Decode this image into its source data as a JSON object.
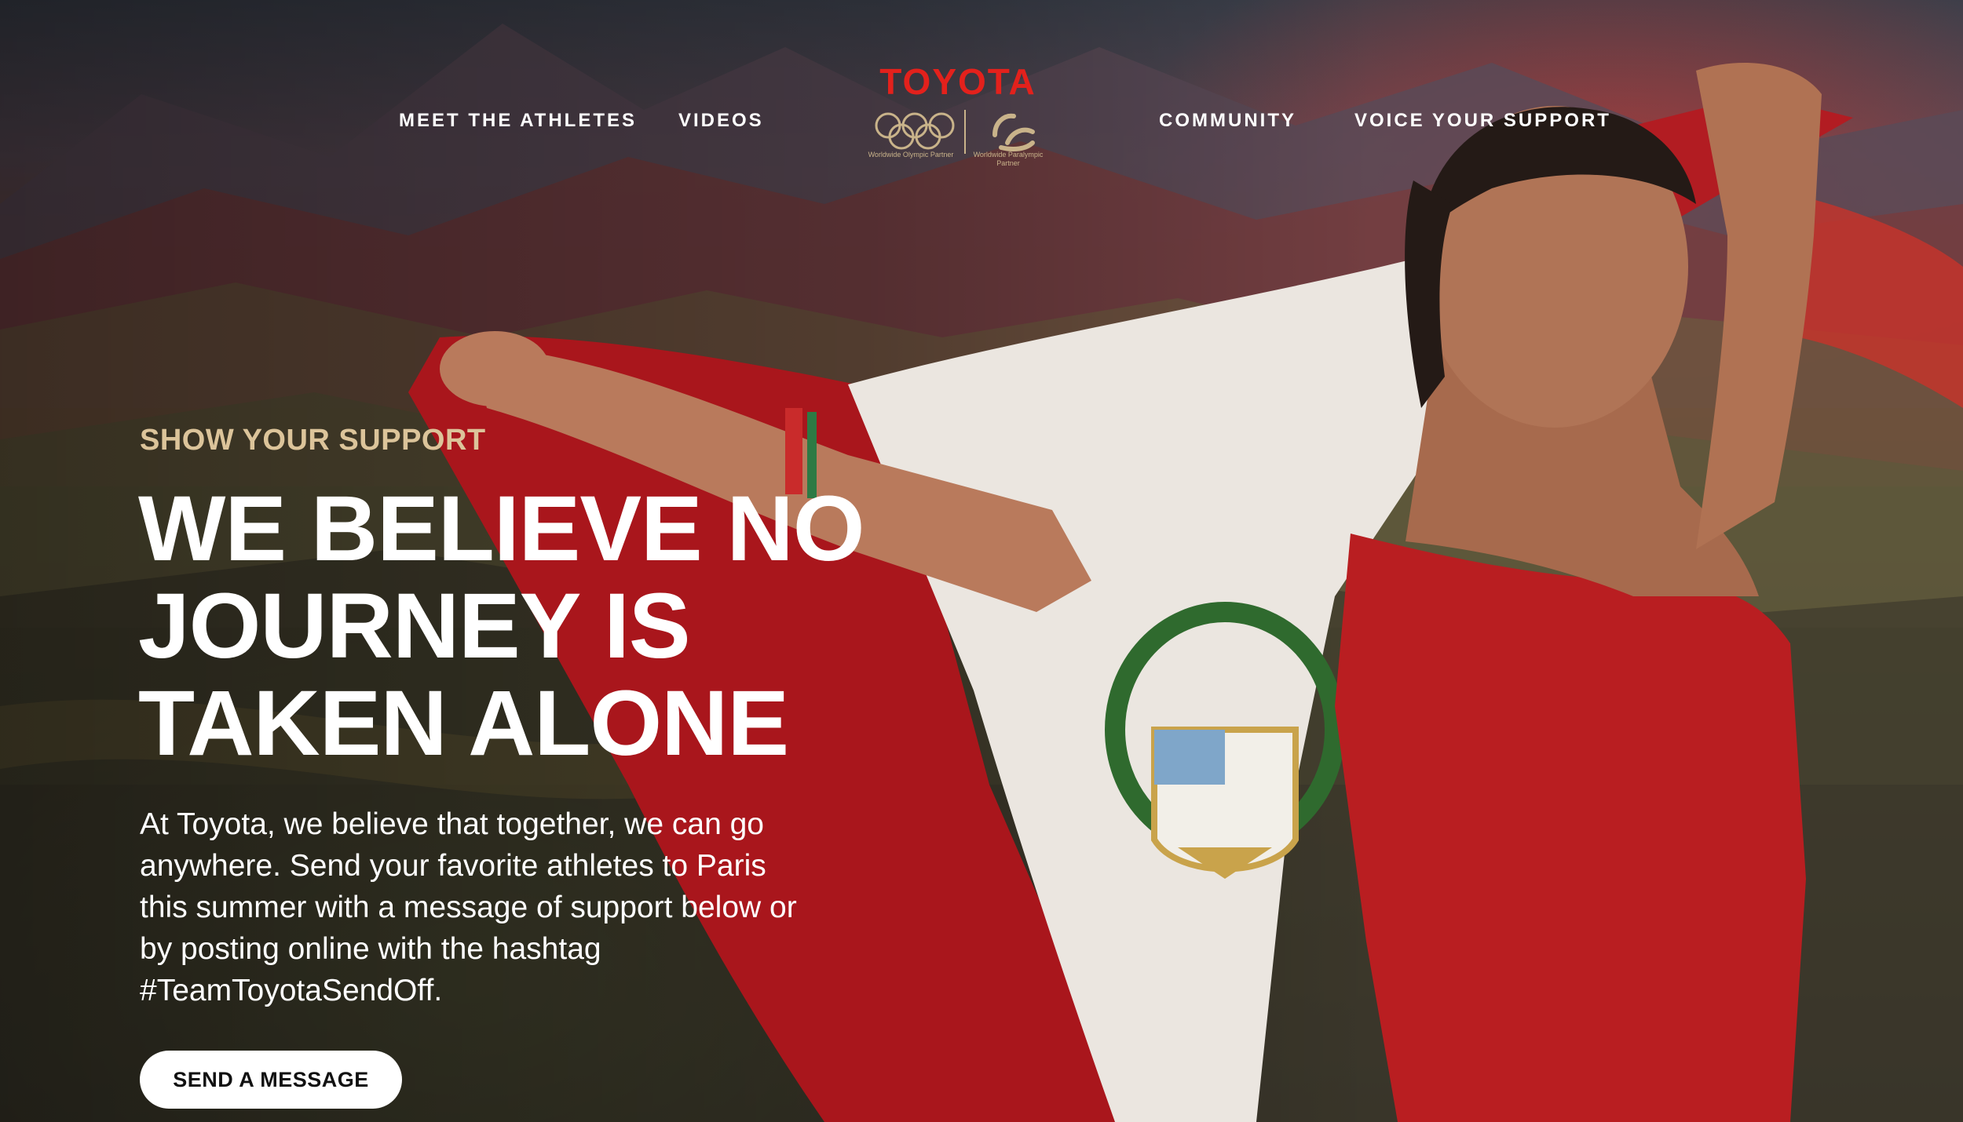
{
  "nav": {
    "left": [
      "MEET THE ATHLETES",
      "VIDEOS"
    ],
    "right": [
      "COMMUNITY",
      "VOICE YOUR SUPPORT"
    ]
  },
  "logo": {
    "wordmark": "TOYOTA",
    "olympic_caption": "Worldwide Olympic Partner",
    "paralympic_caption": "Worldwide Paralympic Partner"
  },
  "hero": {
    "eyebrow": "SHOW YOUR SUPPORT",
    "headline_lines": [
      "WE BELIEVE NO",
      "JOURNEY IS",
      "TAKEN ALONE"
    ],
    "body_lines": [
      "At Toyota, we believe that together, we can go",
      "anywhere. Send your favorite athletes to Paris",
      "this summer with a message of support below or",
      "by posting online with the hashtag",
      "#TeamToyotaSendOff."
    ],
    "cta_label": "SEND A MESSAGE"
  },
  "colors": {
    "brand_red": "#e3211c",
    "gold": "#dcc49a",
    "flag_red": "#b3161c",
    "white": "#ffffff"
  }
}
